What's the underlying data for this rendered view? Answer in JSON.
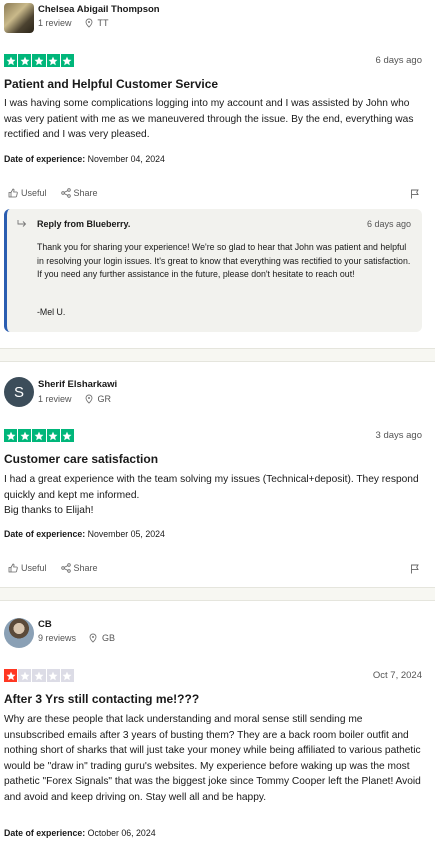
{
  "reviews": [
    {
      "name": "Chelsea Abigail Thompson",
      "review_count": "1 review",
      "country": "TT",
      "rating": 5,
      "date": "6 days ago",
      "title": "Patient and Helpful Customer Service",
      "body": "I was having some complications logging into my account and I was assisted by John who was very patient with me as we maneuvered through the issue. By the end, everything was rectified and I was very pleased.",
      "experience_label": "Date of experience:",
      "experience_date": "November 04, 2024",
      "useful_label": "Useful",
      "share_label": "Share",
      "reply": {
        "header": "Reply from Blueberry.",
        "date": "6 days ago",
        "text": "Thank you for sharing your experience! We're so glad to hear that John was patient and helpful in resolving your login issues. It's great to know that everything was rectified to your satisfaction. If you need any further assistance in the future, please don't hesitate to reach out!",
        "signature": "-Mel U."
      }
    },
    {
      "name": "Sherif Elsharkawi",
      "avatar_letter": "S",
      "review_count": "1 review",
      "country": "GR",
      "rating": 5,
      "date": "3 days ago",
      "title": "Customer care satisfaction",
      "body_lines": [
        "I had a great experience with the team solving my issues (Technical+deposit). They respond quickly and kept me informed.",
        "Big thanks to Elijah!"
      ],
      "experience_label": "Date of experience:",
      "experience_date": "November 05, 2024",
      "useful_label": "Useful",
      "share_label": "Share"
    },
    {
      "name": "CB",
      "review_count": "9 reviews",
      "country": "GB",
      "rating": 1,
      "date": "Oct 7, 2024",
      "title": "After 3 Yrs still contacting me!???",
      "body": "Why are these people that lack understanding and moral sense still sending me unsubscribed emails after 3 years of busting them? They are a back room boiler outfit and nothing short of sharks that will just take your money while being affiliated to various pathetic would be \"draw in\" trading guru's websites. My experience before waking up was the most pathetic \"Forex Signals\" that was the biggest joke since Tommy Cooper left the Planet! Avoid and avoid and keep driving on. Stay well all and be happy.",
      "experience_label": "Date of experience:",
      "experience_date": "October 06, 2024"
    }
  ],
  "colors": {
    "star_green": "#00b67a",
    "star_red": "#ff3722",
    "star_empty": "#dcdce6",
    "reply_border": "#2a5db0"
  },
  "icons": [
    "location-pin-icon",
    "thumbs-up-icon",
    "share-icon",
    "flag-icon",
    "reply-arrow-icon",
    "star-icon"
  ]
}
